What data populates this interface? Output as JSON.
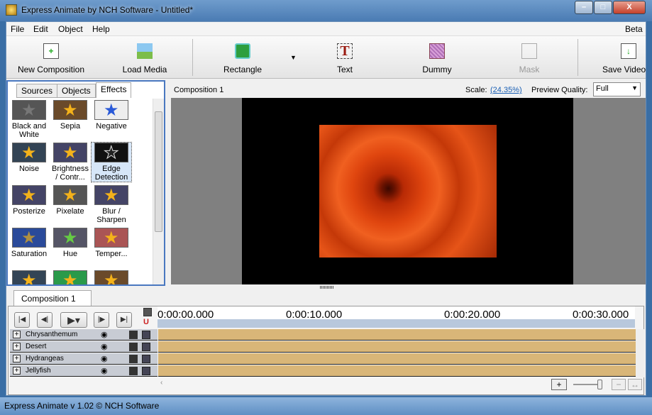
{
  "window": {
    "title": "Express Animate by NCH Software - Untitled*",
    "min": "–",
    "max": "□",
    "close": "X"
  },
  "menu": {
    "items": [
      "File",
      "Edit",
      "Object",
      "Help"
    ],
    "beta": "Beta"
  },
  "toolbar": {
    "new_composition": "New Composition",
    "load_media": "Load Media",
    "rectangle": "Rectangle",
    "text": "Text",
    "dummy": "Dummy",
    "mask": "Mask",
    "save_video": "Save Video"
  },
  "left_panel": {
    "tabs": [
      "Sources",
      "Objects",
      "Effects"
    ],
    "active_tab": "Effects",
    "effects": [
      "Black and White",
      "Sepia",
      "Negative",
      "Noise",
      "Brightness / Contr...",
      "Edge Detection",
      "Posterize",
      "Pixelate",
      "Blur / Sharpen",
      "Saturation",
      "Hue",
      "Temper..."
    ],
    "selected": "Edge Detection"
  },
  "preview": {
    "composition": "Composition 1",
    "scale_label": "Scale:",
    "scale_value": "(24.35%)",
    "quality_label": "Preview Quality:",
    "quality_value": "Full"
  },
  "timeline": {
    "tab": "Composition 1",
    "times": [
      "0:00:00.000",
      "0:00:10.000",
      "0:00:20.000",
      "0:00:30.000"
    ],
    "tracks": [
      "Chrysanthemum",
      "Desert",
      "Hydrangeas",
      "Jellyfish"
    ],
    "zoom_in": "+",
    "zoom_out": "−"
  },
  "colors": {
    "track_bar": "#d9b678",
    "accent": "#4a78c0",
    "link": "#1a5fb4"
  },
  "status": "Express Animate v 1.02 © NCH Software"
}
